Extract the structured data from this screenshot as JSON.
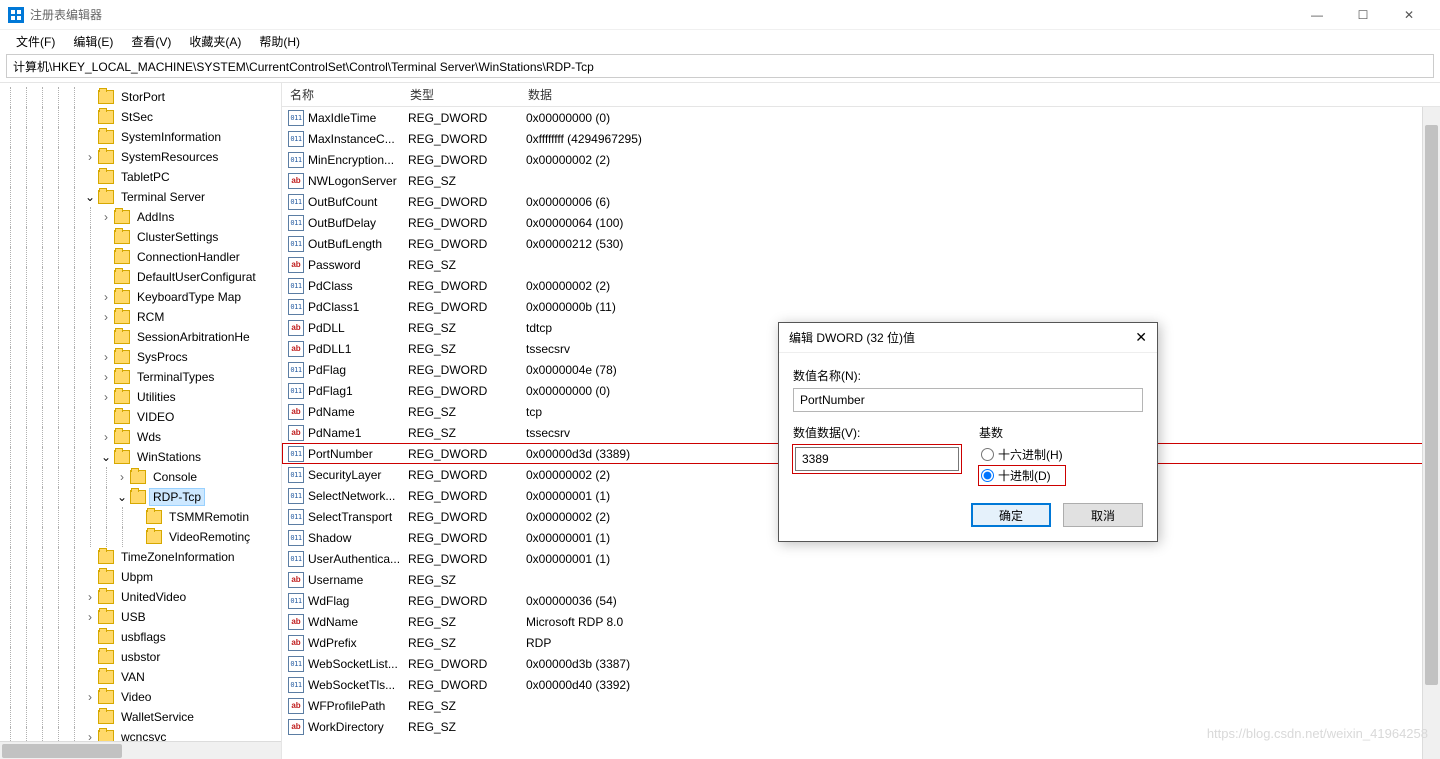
{
  "window": {
    "title": "注册表编辑器",
    "min": "—",
    "max": "☐",
    "close": "✕"
  },
  "menu": {
    "file": "文件(F)",
    "edit": "编辑(E)",
    "view": "查看(V)",
    "fav": "收藏夹(A)",
    "help": "帮助(H)"
  },
  "address": "计算机\\HKEY_LOCAL_MACHINE\\SYSTEM\\CurrentControlSet\\Control\\Terminal Server\\WinStations\\RDP-Tcp",
  "tree": [
    {
      "indent": 5,
      "chev": "",
      "label": "StorPort"
    },
    {
      "indent": 5,
      "chev": "",
      "label": "StSec"
    },
    {
      "indent": 5,
      "chev": "",
      "label": "SystemInformation"
    },
    {
      "indent": 5,
      "chev": "r",
      "label": "SystemResources"
    },
    {
      "indent": 5,
      "chev": "",
      "label": "TabletPC"
    },
    {
      "indent": 5,
      "chev": "d",
      "label": "Terminal Server"
    },
    {
      "indent": 6,
      "chev": "r",
      "label": "AddIns"
    },
    {
      "indent": 6,
      "chev": "",
      "label": "ClusterSettings"
    },
    {
      "indent": 6,
      "chev": "",
      "label": "ConnectionHandler"
    },
    {
      "indent": 6,
      "chev": "",
      "label": "DefaultUserConfigurat"
    },
    {
      "indent": 6,
      "chev": "r",
      "label": "KeyboardType Map"
    },
    {
      "indent": 6,
      "chev": "r",
      "label": "RCM"
    },
    {
      "indent": 6,
      "chev": "",
      "label": "SessionArbitrationHe"
    },
    {
      "indent": 6,
      "chev": "r",
      "label": "SysProcs"
    },
    {
      "indent": 6,
      "chev": "r",
      "label": "TerminalTypes"
    },
    {
      "indent": 6,
      "chev": "r",
      "label": "Utilities"
    },
    {
      "indent": 6,
      "chev": "",
      "label": "VIDEO"
    },
    {
      "indent": 6,
      "chev": "r",
      "label": "Wds"
    },
    {
      "indent": 6,
      "chev": "d",
      "label": "WinStations"
    },
    {
      "indent": 7,
      "chev": "r",
      "label": "Console"
    },
    {
      "indent": 7,
      "chev": "d",
      "label": "RDP-Tcp",
      "selected": true
    },
    {
      "indent": 8,
      "chev": "",
      "label": "TSMMRemotin"
    },
    {
      "indent": 8,
      "chev": "",
      "label": "VideoRemotinç"
    },
    {
      "indent": 5,
      "chev": "",
      "label": "TimeZoneInformation"
    },
    {
      "indent": 5,
      "chev": "",
      "label": "Ubpm"
    },
    {
      "indent": 5,
      "chev": "r",
      "label": "UnitedVideo"
    },
    {
      "indent": 5,
      "chev": "r",
      "label": "USB"
    },
    {
      "indent": 5,
      "chev": "",
      "label": "usbflags"
    },
    {
      "indent": 5,
      "chev": "",
      "label": "usbstor"
    },
    {
      "indent": 5,
      "chev": "",
      "label": "VAN"
    },
    {
      "indent": 5,
      "chev": "r",
      "label": "Video"
    },
    {
      "indent": 5,
      "chev": "",
      "label": "WalletService"
    },
    {
      "indent": 5,
      "chev": "r",
      "label": "wcncsvc"
    }
  ],
  "listHeader": {
    "name": "名称",
    "type": "类型",
    "data": "数据"
  },
  "rows": [
    {
      "icon": "dw",
      "name": "MaxIdleTime",
      "type": "REG_DWORD",
      "data": "0x00000000 (0)"
    },
    {
      "icon": "dw",
      "name": "MaxInstanceC...",
      "type": "REG_DWORD",
      "data": "0xffffffff (4294967295)"
    },
    {
      "icon": "dw",
      "name": "MinEncryption...",
      "type": "REG_DWORD",
      "data": "0x00000002 (2)"
    },
    {
      "icon": "sz",
      "name": "NWLogonServer",
      "type": "REG_SZ",
      "data": ""
    },
    {
      "icon": "dw",
      "name": "OutBufCount",
      "type": "REG_DWORD",
      "data": "0x00000006 (6)"
    },
    {
      "icon": "dw",
      "name": "OutBufDelay",
      "type": "REG_DWORD",
      "data": "0x00000064 (100)"
    },
    {
      "icon": "dw",
      "name": "OutBufLength",
      "type": "REG_DWORD",
      "data": "0x00000212 (530)"
    },
    {
      "icon": "sz",
      "name": "Password",
      "type": "REG_SZ",
      "data": ""
    },
    {
      "icon": "dw",
      "name": "PdClass",
      "type": "REG_DWORD",
      "data": "0x00000002 (2)"
    },
    {
      "icon": "dw",
      "name": "PdClass1",
      "type": "REG_DWORD",
      "data": "0x0000000b (11)"
    },
    {
      "icon": "sz",
      "name": "PdDLL",
      "type": "REG_SZ",
      "data": "tdtcp"
    },
    {
      "icon": "sz",
      "name": "PdDLL1",
      "type": "REG_SZ",
      "data": "tssecsrv"
    },
    {
      "icon": "dw",
      "name": "PdFlag",
      "type": "REG_DWORD",
      "data": "0x0000004e (78)"
    },
    {
      "icon": "dw",
      "name": "PdFlag1",
      "type": "REG_DWORD",
      "data": "0x00000000 (0)"
    },
    {
      "icon": "sz",
      "name": "PdName",
      "type": "REG_SZ",
      "data": "tcp"
    },
    {
      "icon": "sz",
      "name": "PdName1",
      "type": "REG_SZ",
      "data": "tssecsrv"
    },
    {
      "icon": "dw",
      "name": "PortNumber",
      "type": "REG_DWORD",
      "data": "0x00000d3d (3389)",
      "hl": true
    },
    {
      "icon": "dw",
      "name": "SecurityLayer",
      "type": "REG_DWORD",
      "data": "0x00000002 (2)"
    },
    {
      "icon": "dw",
      "name": "SelectNetwork...",
      "type": "REG_DWORD",
      "data": "0x00000001 (1)"
    },
    {
      "icon": "dw",
      "name": "SelectTransport",
      "type": "REG_DWORD",
      "data": "0x00000002 (2)"
    },
    {
      "icon": "dw",
      "name": "Shadow",
      "type": "REG_DWORD",
      "data": "0x00000001 (1)"
    },
    {
      "icon": "dw",
      "name": "UserAuthentica...",
      "type": "REG_DWORD",
      "data": "0x00000001 (1)"
    },
    {
      "icon": "sz",
      "name": "Username",
      "type": "REG_SZ",
      "data": ""
    },
    {
      "icon": "dw",
      "name": "WdFlag",
      "type": "REG_DWORD",
      "data": "0x00000036 (54)"
    },
    {
      "icon": "sz",
      "name": "WdName",
      "type": "REG_SZ",
      "data": "Microsoft RDP 8.0"
    },
    {
      "icon": "sz",
      "name": "WdPrefix",
      "type": "REG_SZ",
      "data": "RDP"
    },
    {
      "icon": "dw",
      "name": "WebSocketList...",
      "type": "REG_DWORD",
      "data": "0x00000d3b (3387)"
    },
    {
      "icon": "dw",
      "name": "WebSocketTls...",
      "type": "REG_DWORD",
      "data": "0x00000d40 (3392)"
    },
    {
      "icon": "sz",
      "name": "WFProfilePath",
      "type": "REG_SZ",
      "data": ""
    },
    {
      "icon": "sz",
      "name": "WorkDirectory",
      "type": "REG_SZ",
      "data": ""
    }
  ],
  "dialog": {
    "title": "编辑 DWORD (32 位)值",
    "nameLabel": "数值名称(N):",
    "nameValue": "PortNumber",
    "dataLabel": "数值数据(V):",
    "dataValue": "3389",
    "baseLabel": "基数",
    "hex": "十六进制(H)",
    "dec": "十进制(D)",
    "ok": "确定",
    "cancel": "取消"
  },
  "watermark": "https://blog.csdn.net/weixin_41964258"
}
